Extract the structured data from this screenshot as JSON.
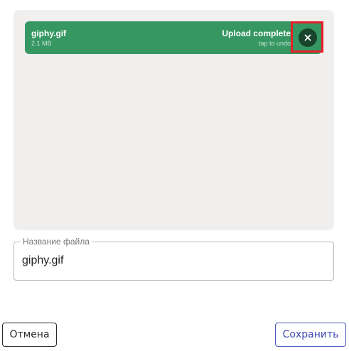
{
  "upload": {
    "file_name": "giphy.gif",
    "file_size": "2.1 MB",
    "status": "Upload complete",
    "status_hint": "tap to undo",
    "close_icon": "close-icon",
    "colors": {
      "item_bg": "#369763",
      "close_bg": "#17442b",
      "highlight": "#e8202a"
    }
  },
  "filename_field": {
    "label": "Название файла",
    "value": "giphy.gif"
  },
  "actions": {
    "cancel_label": "Отмена",
    "save_label": "Сохранить",
    "colors": {
      "save": "#3f4bb0"
    }
  }
}
